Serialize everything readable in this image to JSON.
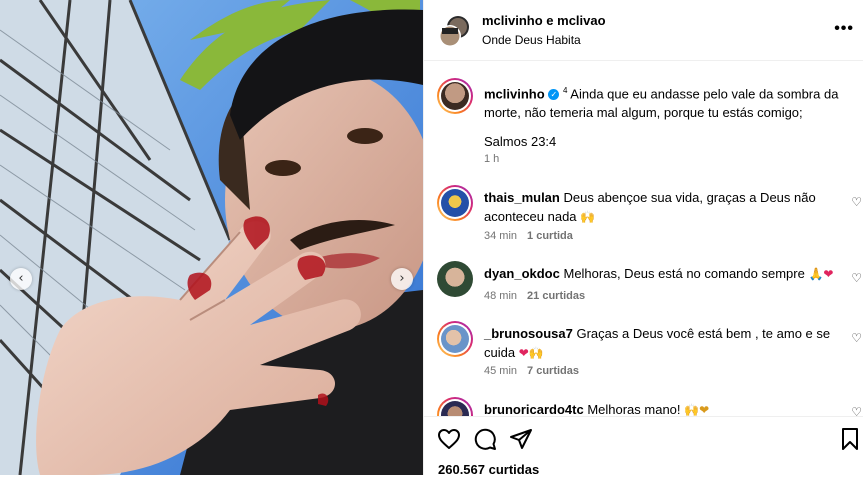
{
  "header": {
    "usernames": "mclivinho e mclivao",
    "location": "Onde Deus Habita",
    "more_icon": "ellipsis-icon"
  },
  "caption": {
    "username": "mclivinho",
    "verse_number": "4",
    "text": "Ainda que eu andasse pelo vale da sombra da morte, não temeria mal algum, porque tu estás comigo;",
    "reference": "Salmos 23:4",
    "time": "1 h"
  },
  "comments": [
    {
      "username": "thais_mulan",
      "text": "Deus abençoe sua vida, graças a Deus não aconteceu nada",
      "emoji": "🙌",
      "time": "34 min",
      "likes": "1 curtida"
    },
    {
      "username": "dyan_okdoc",
      "text": "Melhoras, Deus está no comando sempre",
      "emoji": "🙏❤",
      "time": "48 min",
      "likes": "21 curtidas"
    },
    {
      "username": "_brunosousa7",
      "text": "Graças a Deus você está bem , te amo e se cuida",
      "emoji": "❤🙌",
      "time": "45 min",
      "likes": "7 curtidas"
    },
    {
      "username": "brunoricardo4tc",
      "text": "Melhoras mano!",
      "emoji": "🙌❤"
    }
  ],
  "likes_count": "260.567 curtidas",
  "carousel": {
    "prev": "‹",
    "next": "›"
  },
  "colors": {
    "verified": "#0095f6",
    "heart": "#e0245e",
    "sky": "#6aa7e8"
  }
}
